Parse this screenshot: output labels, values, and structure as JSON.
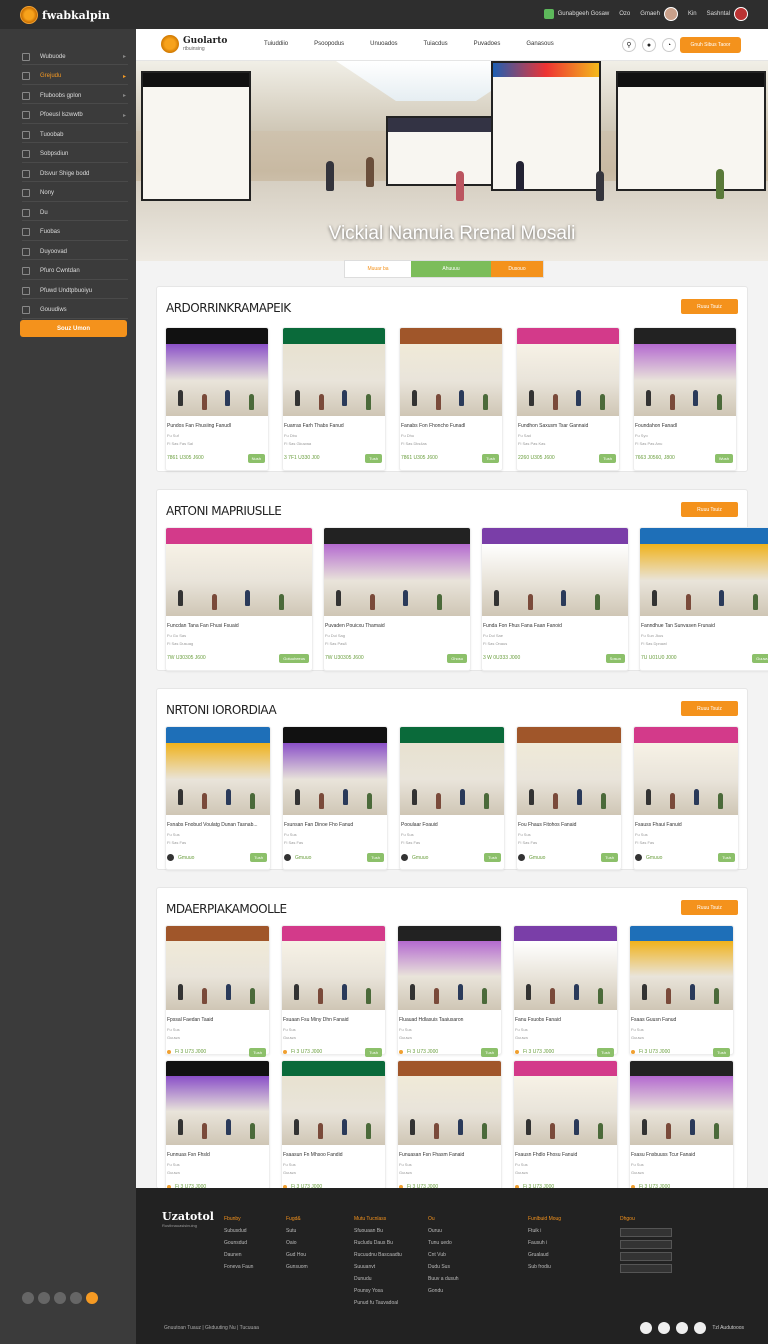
{
  "app": {
    "brand": "fwabkalpin"
  },
  "topbar": {
    "item1": "Gunabgeeh Gosaw",
    "item2": "Ozo",
    "item3": "Gmaeh",
    "item4": "Kin",
    "item5": "Sashntal"
  },
  "sidebar": {
    "items": [
      {
        "label": "Wubuode",
        "icon": "grid-icon",
        "active": false,
        "arrow": "▸"
      },
      {
        "label": "Grejudu",
        "icon": "grid-icon",
        "active": true,
        "arrow": "▸"
      },
      {
        "label": "Ftuboobs gplon",
        "icon": "grid-icon",
        "active": false,
        "arrow": "▸"
      },
      {
        "label": "Pfoeusl lszwwtb",
        "icon": "grid-icon",
        "active": false,
        "arrow": "▸"
      },
      {
        "label": "Tuoobab",
        "icon": "grid-icon",
        "active": false,
        "arrow": ""
      },
      {
        "label": "Sobpsdiun",
        "icon": "grid-icon",
        "active": false,
        "arrow": ""
      },
      {
        "label": "Dtsvur Shige bodd",
        "icon": "grid-icon",
        "active": false,
        "arrow": ""
      },
      {
        "label": "Nony",
        "icon": "grid-icon",
        "active": false,
        "arrow": ""
      },
      {
        "label": "Du",
        "icon": "grid-icon",
        "active": false,
        "arrow": ""
      },
      {
        "label": "Fuobas",
        "icon": "grid-icon",
        "active": false,
        "arrow": ""
      },
      {
        "label": "Duyoovad",
        "icon": "gear-icon",
        "active": false,
        "arrow": ""
      },
      {
        "label": "Pfuro Cwntdan",
        "icon": "gear-icon",
        "active": false,
        "arrow": ""
      },
      {
        "label": "Pfuwd Undtpbuoiyu",
        "icon": "gear-icon",
        "active": false,
        "arrow": ""
      },
      {
        "label": "Gouudiws",
        "icon": "gear-icon",
        "active": false,
        "arrow": ""
      }
    ],
    "button": "Souz Umon"
  },
  "header": {
    "logo_title": "Guolarto",
    "logo_sub": "rtbuinsing",
    "nav": [
      "Tuiuddiio",
      "Psoopodus",
      "Unuoados",
      "Tuiacdus",
      "Puvadoes",
      "Ganasous"
    ],
    "cta": "Gnuh Sibus Taoor"
  },
  "hero": {
    "title": "Vickial Namuia Rrenal Mosali",
    "pill_left": "Muuar ba",
    "pill_mid": "Ahuuuu",
    "pill_right": "Dusouo"
  },
  "sections": [
    {
      "title": "ARDORRINKRAMAPEIK",
      "button": "Ruuu Tsuiz",
      "cards": [
        {
          "title": "Pundos Fan Fhusiing Fanudl",
          "meta": "Fu Suf",
          "meta2": "Fi Sas Fas Sal",
          "price": "7861 U305 J600",
          "btn": "Nush"
        },
        {
          "title": "Fuarras Farh Thabs Fanud",
          "meta": "Fu Dbu",
          "meta2": "Fi Sas Gkuwaa",
          "price": "3 7F1 U330 J00",
          "btn": "Tush"
        },
        {
          "title": "Fanabs Fon Fhoncho Funadl",
          "meta": "Fu Dhu",
          "meta2": "Fi Sas Dks4as",
          "price": "7861 U305 J600",
          "btn": "Tush"
        },
        {
          "title": "Fundhon Saxusm Tsar Gannaid",
          "meta": "Fu Sad",
          "meta2": "Fi Sas Pas Kas",
          "price": "2260 U305 J600",
          "btn": "Tush"
        },
        {
          "title": "Foundahon Fanadl",
          "meta": "Fu Syo",
          "meta2": "Fi Sas Pas Anu",
          "price": "7663 J0560, J800",
          "btn": "Wush"
        }
      ]
    },
    {
      "title": "ARTONI MAPRIUSLLE",
      "button": "Ruuu Tsuiz",
      "cards": [
        {
          "title": "Funcdan Tana Fan Fhusi Fsuaid",
          "meta": "Fu Gu Sas",
          "meta2": "Fi Sas Dusuag",
          "price": "7W U30305 J600",
          "btn": "Gotuuheeus"
        },
        {
          "title": "Puvaden Pouicxu Thamaid",
          "meta": "Fu Dui Sag",
          "meta2": "Fi Sas Pas8",
          "price": "7W U30305 J600",
          "btn": "Ghosu"
        },
        {
          "title": "Funda Fon Fhus Fana Faan Fanoid",
          "meta": "Fu Dui Sae",
          "meta2": "Fi Sas Onaus",
          "price": "3 W 0U333 J000",
          "btn": "Sosun"
        },
        {
          "title": "Fanndhue Tan Sunvasen Frunaid",
          "meta": "Fu Sun Jkus",
          "meta2": "Fi Sas Dpnawl",
          "price": "7U U01U0 J000",
          "btn": "Guuwuheeur"
        }
      ]
    },
    {
      "title": "NRTONI IORORDIAA",
      "button": "Ruuu Tsuiz",
      "cards": [
        {
          "title": "Fsnabs Fnobud Voulatg Dunan Tasnab...",
          "meta": "Fu Sus",
          "meta2": "Fi Sas Fas",
          "price": "Gmuuo",
          "btn": "Tush"
        },
        {
          "title": "Fsunsan Fan Dinoe Fho Fanud",
          "meta": "Fu Sus",
          "meta2": "Fi Sas Fas",
          "price": "Gmuuo",
          "btn": "Tush"
        },
        {
          "title": "Pooulaar Foauid",
          "meta": "Fu Sus",
          "meta2": "Fi Sas Fas",
          "price": "Gmuuo",
          "btn": "Tush"
        },
        {
          "title": "Fou Fhaus Fitohos Fanaid",
          "meta": "Fu Sus",
          "meta2": "Fi Sas Fas",
          "price": "Gmuuo",
          "btn": "Tush"
        },
        {
          "title": "Fsauss Fhaui Fanuid",
          "meta": "Fu Sus",
          "meta2": "Fi Sas Fas",
          "price": "Gmuuo",
          "btn": "Tush"
        }
      ]
    },
    {
      "title": "MDAERPIAKAMOOLLE",
      "button": "Ruuu Tsuiz",
      "cards": [
        {
          "title": "Fpssal Faedan Taaid",
          "meta": "Fu Sus",
          "meta2": "Guuwa",
          "price": "Fi 3 U73 J000",
          "btn": "Tush"
        },
        {
          "title": "Fsuaan Fsu Miny Dhn Fanaid",
          "meta": "Fu Sus",
          "meta2": "Guuwa",
          "price": "Fi 3 U73 J000",
          "btn": "Tush"
        },
        {
          "title": "Fluauad Hdlasuis Taaiusaron",
          "meta": "Fu Sus",
          "meta2": "Guuwa",
          "price": "Fi 3 U73 J000",
          "btn": "Tush"
        },
        {
          "title": "Fanu Fsuobs Fanaid",
          "meta": "Fu Sus",
          "meta2": "Guuwa",
          "price": "Fi 3 U73 J000",
          "btn": "Tush"
        },
        {
          "title": "Fsaas Guusn Fanud",
          "meta": "Fu Sus",
          "meta2": "Guuwa",
          "price": "Fi 3 U73 J000",
          "btn": "Tush"
        },
        {
          "title": "Funnuas Fsn Fhsld",
          "meta": "Fu Sus",
          "meta2": "Guuwa",
          "price": "Fi 3 U73 J000",
          "btn": ""
        },
        {
          "title": "Fsaasun Fn Mhsoo Fandid",
          "meta": "Fu Sus",
          "meta2": "Guuwa",
          "price": "Fi 3 U73 J000",
          "btn": ""
        },
        {
          "title": "Funuasan Fsn Fhasm Fanaid",
          "meta": "Fu Sus",
          "meta2": "Guuwa",
          "price": "Fi 3 U73 J000",
          "btn": ""
        },
        {
          "title": "Fsausn Fhdlo Fhosu Fanuid",
          "meta": "Fu Sus",
          "meta2": "Guuwa",
          "price": "Fi 3 U73 J000",
          "btn": ""
        },
        {
          "title": "Fsasu Fnsbuuss Tcur Fanaid",
          "meta": "Fu Sus",
          "meta2": "Guuwa",
          "price": "Fi 3 U73 J000",
          "btn": ""
        }
      ]
    }
  ],
  "footer": {
    "logo": "Uzatotol",
    "logo_sub": "Rustbnauasisinuing",
    "cols": [
      {
        "hd": "Fbunby",
        "items": [
          "Subusdud",
          "Gounsdud",
          "Daunen",
          "Foneva Faun"
        ]
      },
      {
        "hd": "Fugd&",
        "items": [
          "Sutu",
          "Oaio",
          "Gud Hou",
          "Gunsuom"
        ]
      },
      {
        "hd": "Mutu Tucnlass",
        "items": [
          "Sfuouaan Bu",
          "Rucludu Daus Bu",
          "Rucuudnu Bascaadtu",
          "Suuuanvt",
          "Dunudu",
          "Pounsy Yosa",
          "Punud fu Tauvadoal"
        ]
      },
      {
        "hd": "Ou",
        "items": [
          "Ouruu",
          "Tunu uedo",
          "Cnt Vub",
          "Dudu Sus",
          "Buuv a dusuh",
          "Gondu"
        ]
      },
      {
        "hd": "Funlbuid Moug",
        "items": [
          "Ftuik i",
          "Fausuh i",
          "Grualaud",
          "Sub frodiu"
        ]
      }
    ],
    "search_hd": "Dhgou",
    "copyright": "Gnuutoan Tuauz | Gkduuting Nu | Tucuuaa",
    "bottom_right": "Tzl Audutooos"
  }
}
